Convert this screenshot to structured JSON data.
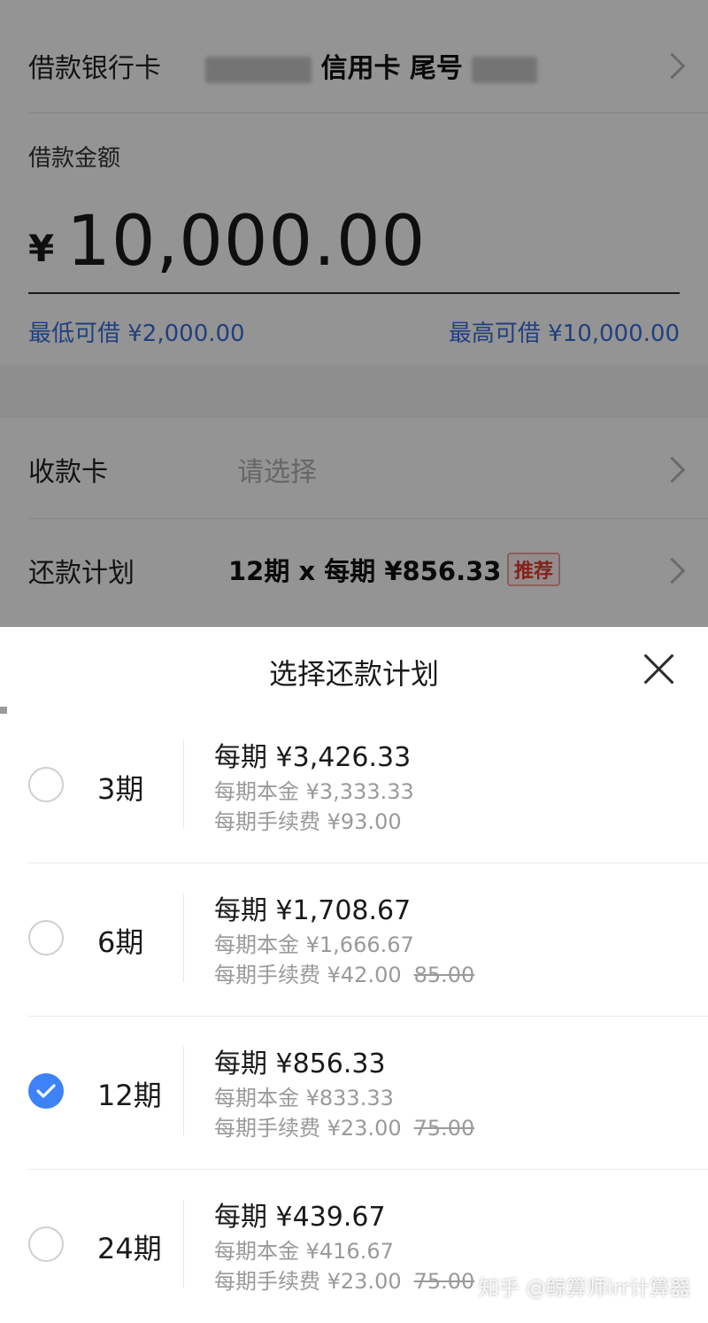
{
  "background": {
    "card_row": {
      "label": "借款银行卡",
      "card_type": "信用卡",
      "tail_label": "尾号"
    },
    "amount": {
      "label": "借款金额",
      "currency": "¥",
      "value": "10,000.00",
      "min_label": "最低可借 ¥2,000.00",
      "max_label": "最高可借 ¥10,000.00"
    },
    "receive_row": {
      "label": "收款卡",
      "placeholder": "请选择"
    },
    "plan_row": {
      "label": "还款计划",
      "value": "12期 x 每期 ¥856.33",
      "tag": "推荐"
    }
  },
  "sheet": {
    "title": "选择还款计划",
    "options": [
      {
        "term": "3期",
        "payment": "每期 ¥3,426.33",
        "principal": "每期本金  ¥3,333.33",
        "fee": "每期手续费  ¥93.00",
        "fee_original": "",
        "selected": false
      },
      {
        "term": "6期",
        "payment": "每期 ¥1,708.67",
        "principal": "每期本金  ¥1,666.67",
        "fee": "每期手续费  ¥42.00",
        "fee_original": "85.00",
        "selected": false
      },
      {
        "term": "12期",
        "payment": "每期 ¥856.33",
        "principal": "每期本金  ¥833.33",
        "fee": "每期手续费  ¥23.00",
        "fee_original": "75.00",
        "selected": true
      },
      {
        "term": "24期",
        "payment": "每期 ¥439.67",
        "principal": "每期本金  ¥416.67",
        "fee": "每期手续费  ¥23.00",
        "fee_original": "75.00",
        "selected": false
      }
    ]
  },
  "watermark": "知乎 @鲸算师irr计算器",
  "colors": {
    "accent_blue": "#3d82f7",
    "link_blue": "#3b6fd8",
    "tag_red": "#e23b2e"
  }
}
